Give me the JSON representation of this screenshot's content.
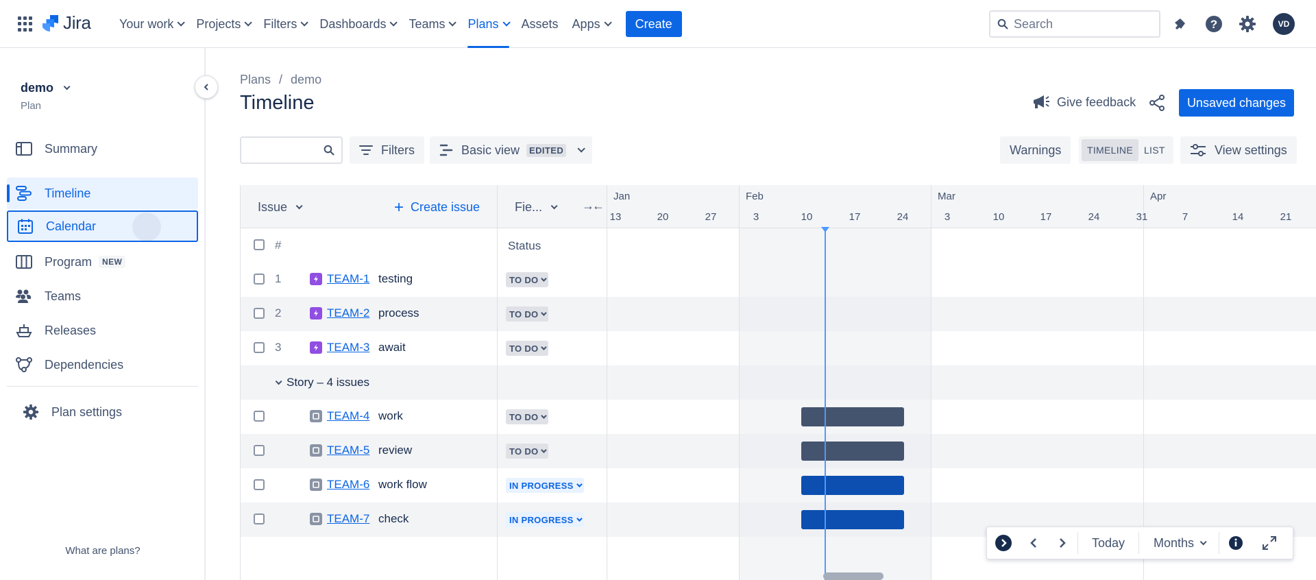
{
  "app": {
    "name": "Jira"
  },
  "topnav": {
    "items": [
      {
        "label": "Your work",
        "has_menu": true
      },
      {
        "label": "Projects",
        "has_menu": true
      },
      {
        "label": "Filters",
        "has_menu": true
      },
      {
        "label": "Dashboards",
        "has_menu": true
      },
      {
        "label": "Teams",
        "has_menu": true
      },
      {
        "label": "Plans",
        "has_menu": true,
        "active": true
      },
      {
        "label": "Assets",
        "has_menu": false
      },
      {
        "label": "Apps",
        "has_menu": true
      }
    ],
    "create_label": "Create",
    "search_placeholder": "Search",
    "avatar_initials": "VD"
  },
  "sidebar": {
    "project_name": "demo",
    "project_type": "Plan",
    "items": [
      {
        "label": "Summary",
        "icon": "summary-icon"
      },
      {
        "label": "Timeline",
        "icon": "timeline-icon",
        "state": "selected"
      },
      {
        "label": "Calendar",
        "icon": "calendar-icon",
        "state": "focused"
      },
      {
        "label": "Program",
        "icon": "program-icon",
        "badge": "NEW"
      },
      {
        "label": "Teams",
        "icon": "teams-icon"
      },
      {
        "label": "Releases",
        "icon": "releases-icon"
      },
      {
        "label": "Dependencies",
        "icon": "dependencies-icon"
      }
    ],
    "plan_settings_label": "Plan settings",
    "footer_link": "What are plans?"
  },
  "header": {
    "breadcrumb": [
      "Plans",
      "demo"
    ],
    "title": "Timeline",
    "give_feedback": "Give feedback",
    "unsaved_changes": "Unsaved changes"
  },
  "toolbar": {
    "search_value": "",
    "filters_label": "Filters",
    "view_label": "Basic view",
    "view_badge": "EDITED",
    "warnings_label": "Warnings",
    "mode_options": [
      "TIMELINE",
      "LIST"
    ],
    "mode_selected": "TIMELINE",
    "view_settings_label": "View settings"
  },
  "grid": {
    "issue_header": "Issue",
    "create_issue": "Create issue",
    "fields_header": "Fie...",
    "collapse_symbol": "→←",
    "number_header": "#",
    "status_header": "Status",
    "months": [
      "Jan",
      "Feb",
      "Mar",
      "Apr"
    ],
    "days": [
      "13",
      "20",
      "27",
      "3",
      "10",
      "17",
      "24",
      "3",
      "10",
      "17",
      "24",
      "31",
      "7",
      "14",
      "21"
    ],
    "rows": [
      {
        "kind": "issue",
        "num": "1",
        "type": "epic",
        "key": "TEAM-1",
        "summary": "testing",
        "status": "TO DO"
      },
      {
        "kind": "issue",
        "num": "2",
        "type": "epic",
        "key": "TEAM-2",
        "summary": "process",
        "status": "TO DO"
      },
      {
        "kind": "issue",
        "num": "3",
        "type": "epic",
        "key": "TEAM-3",
        "summary": "await",
        "status": "TO DO"
      },
      {
        "kind": "group",
        "label": "Story – 4 issues"
      },
      {
        "kind": "issue",
        "num": "",
        "type": "story",
        "key": "TEAM-4",
        "summary": "work",
        "status": "TO DO",
        "bar": {
          "start": "Feb 9",
          "end": "Feb 25",
          "color": "#44546f"
        }
      },
      {
        "kind": "issue",
        "num": "",
        "type": "story",
        "key": "TEAM-5",
        "summary": "review",
        "status": "TO DO",
        "bar": {
          "start": "Feb 9",
          "end": "Feb 25",
          "color": "#44546f"
        }
      },
      {
        "kind": "issue",
        "num": "",
        "type": "story",
        "key": "TEAM-6",
        "summary": "work flow",
        "status": "IN PROGRESS",
        "bar": {
          "start": "Feb 9",
          "end": "Feb 25",
          "color": "#0c4fb0"
        }
      },
      {
        "kind": "issue",
        "num": "",
        "type": "story",
        "key": "TEAM-7",
        "summary": "check",
        "status": "IN PROGRESS",
        "bar": {
          "start": "Feb 9",
          "end": "Feb 25",
          "color": "#0c4fb0"
        }
      }
    ]
  },
  "controls": {
    "today_label": "Today",
    "scale_label": "Months"
  },
  "colors": {
    "brand": "#0c66e4",
    "todo_bar": "#44546f",
    "in_progress_bar": "#0c4fb0",
    "today_line": "#4c9aff",
    "epic_icon": "#904ee2"
  }
}
